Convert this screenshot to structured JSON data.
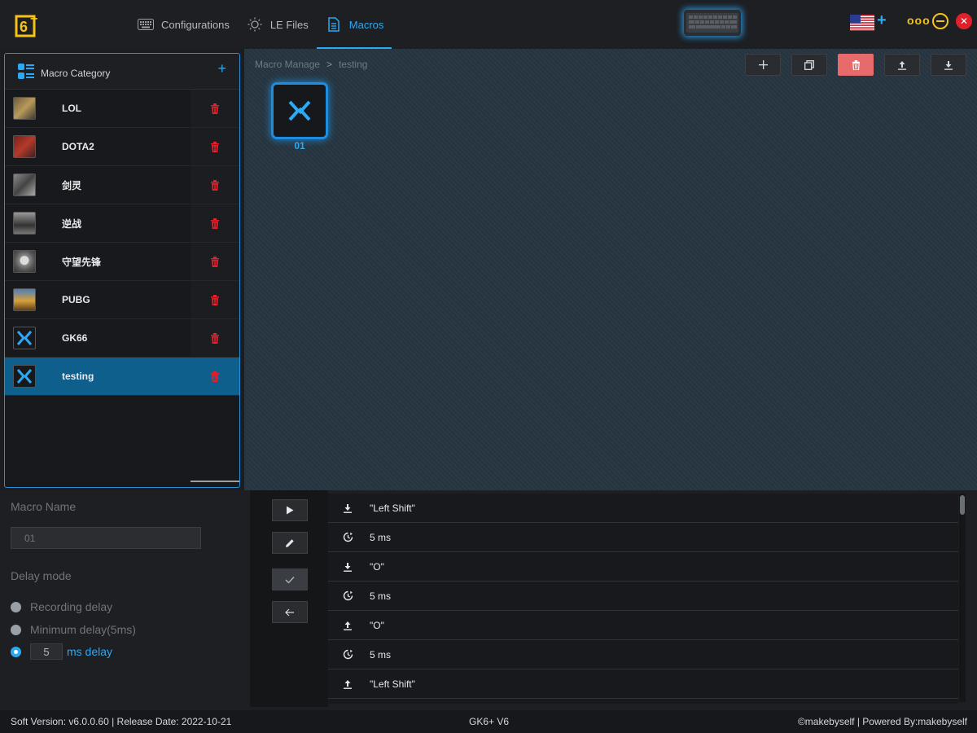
{
  "topbar": {
    "logo": "6+ logo",
    "nav": [
      {
        "label": "Configurations",
        "icon": "keyboard-icon",
        "active": false
      },
      {
        "label": "LE Files",
        "icon": "bulb-icon",
        "active": false
      },
      {
        "label": "Macros",
        "icon": "document-icon",
        "active": true
      }
    ],
    "device_icon": "keyboard-device-icon",
    "language_icon": "us-flag-icon",
    "language_add": "+",
    "more_icon": "ooo",
    "minimize_icon": "minimize-icon",
    "close_icon": "close-icon"
  },
  "category": {
    "title": "Macro Category",
    "add_label": "+",
    "items": [
      {
        "label": "LOL",
        "selected": false
      },
      {
        "label": "DOTA2",
        "selected": false
      },
      {
        "label": "剑灵",
        "selected": false
      },
      {
        "label": "逆战",
        "selected": false
      },
      {
        "label": "守望先锋",
        "selected": false
      },
      {
        "label": "PUBG",
        "selected": false
      },
      {
        "label": "GK66",
        "selected": false
      },
      {
        "label": "testing",
        "selected": true
      }
    ]
  },
  "main": {
    "breadcrumb": [
      "Macro Manage",
      "testing"
    ],
    "toolbar": [
      "plus-icon",
      "copy-icon",
      "trash-icon",
      "upload-icon",
      "download-icon"
    ],
    "macros": [
      {
        "label": "01"
      }
    ]
  },
  "editor": {
    "macro_name_label": "Macro Name",
    "macro_name_placeholder": "01",
    "delay_mode_label": "Delay mode",
    "delay_options": [
      {
        "label": "Recording delay",
        "checked": false
      },
      {
        "label": "Minimum delay(5ms)",
        "checked": false
      },
      {
        "label": "ms delay",
        "checked": true,
        "value": "5"
      }
    ],
    "controls": [
      "play-icon",
      "pencil-icon",
      "check-icon",
      "arrow-left-icon"
    ],
    "steps": [
      {
        "type": "key-down",
        "text": "\"Left Shift\""
      },
      {
        "type": "delay",
        "text": "5 ms"
      },
      {
        "type": "key-down",
        "text": "\"O\""
      },
      {
        "type": "delay",
        "text": "5 ms"
      },
      {
        "type": "key-up",
        "text": "\"O\""
      },
      {
        "type": "delay",
        "text": "5 ms"
      },
      {
        "type": "key-up",
        "text": "\"Left Shift\""
      }
    ]
  },
  "status": {
    "left": "Soft Version: v6.0.0.60 | Release Date: 2022-10-21",
    "middle": "GK6+ V6",
    "right": "©makebyself | Powered By:makebyself"
  },
  "colors": {
    "accent": "#2aaaf5",
    "danger": "#e0202a",
    "yellow": "#f5c219",
    "selected": "#0e5f8c"
  }
}
